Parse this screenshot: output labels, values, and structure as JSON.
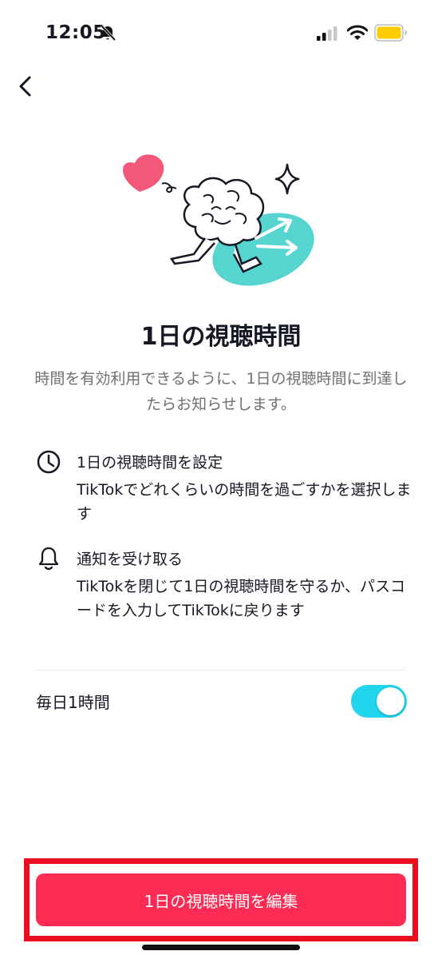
{
  "status_bar": {
    "time": "12:05"
  },
  "page": {
    "title": "1日の視聴時間",
    "description": "時間を有効利用できるように、1日の視聴時間に到達したらお知らせします。"
  },
  "features": [
    {
      "icon": "clock-icon",
      "title": "1日の視聴時間を設定",
      "body": "TikTokでどれくらいの時間を過ごすかを選択します"
    },
    {
      "icon": "bell-icon",
      "title": "通知を受け取る",
      "body": "TikTokを閉じて1日の視聴時間を守るか、パスコードを入力してTikTokに戻ります"
    }
  ],
  "daily_limit": {
    "label": "毎日1時間",
    "enabled": true
  },
  "primary_button": {
    "label": "1日の視聴時間を編集"
  },
  "colors": {
    "accent": "#fe2c55",
    "toggle_on": "#20d5ec",
    "highlight": "#e90e20",
    "heart": "#f2587a",
    "teal": "#56d4cf"
  }
}
